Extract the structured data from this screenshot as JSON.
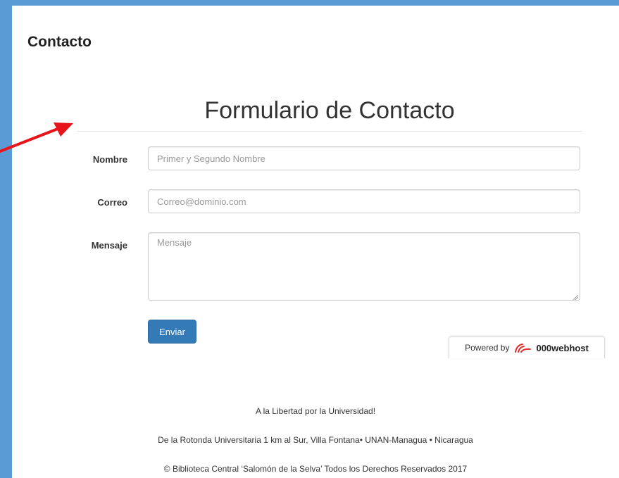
{
  "page": {
    "heading": "Contacto"
  },
  "form": {
    "title": "Formulario de Contacto",
    "name_label": "Nombre",
    "name_placeholder": "Primer y Segundo Nombre",
    "email_label": "Correo",
    "email_placeholder": "Correo@dominio.com",
    "message_label": "Mensaje",
    "message_placeholder": "Mensaje",
    "submit_label": "Enviar"
  },
  "badge": {
    "prefix": "Powered by",
    "brand": "000webhost",
    "icon": "000webhost-logo-icon"
  },
  "footer": {
    "motto": "A la Libertad por la Universidad!",
    "address": "De la Rotonda Universitaria 1 km al Sur, Villa Fontana• UNAN-Managua • Nicaragua",
    "copyright": "© Biblioteca Central ‘Salomón de la Selva’ Todos los Derechos Reservados 2017"
  },
  "colors": {
    "background": "#5b9bd5",
    "primary_button": "#337ab7",
    "annotation_arrow": "#e8141b"
  }
}
